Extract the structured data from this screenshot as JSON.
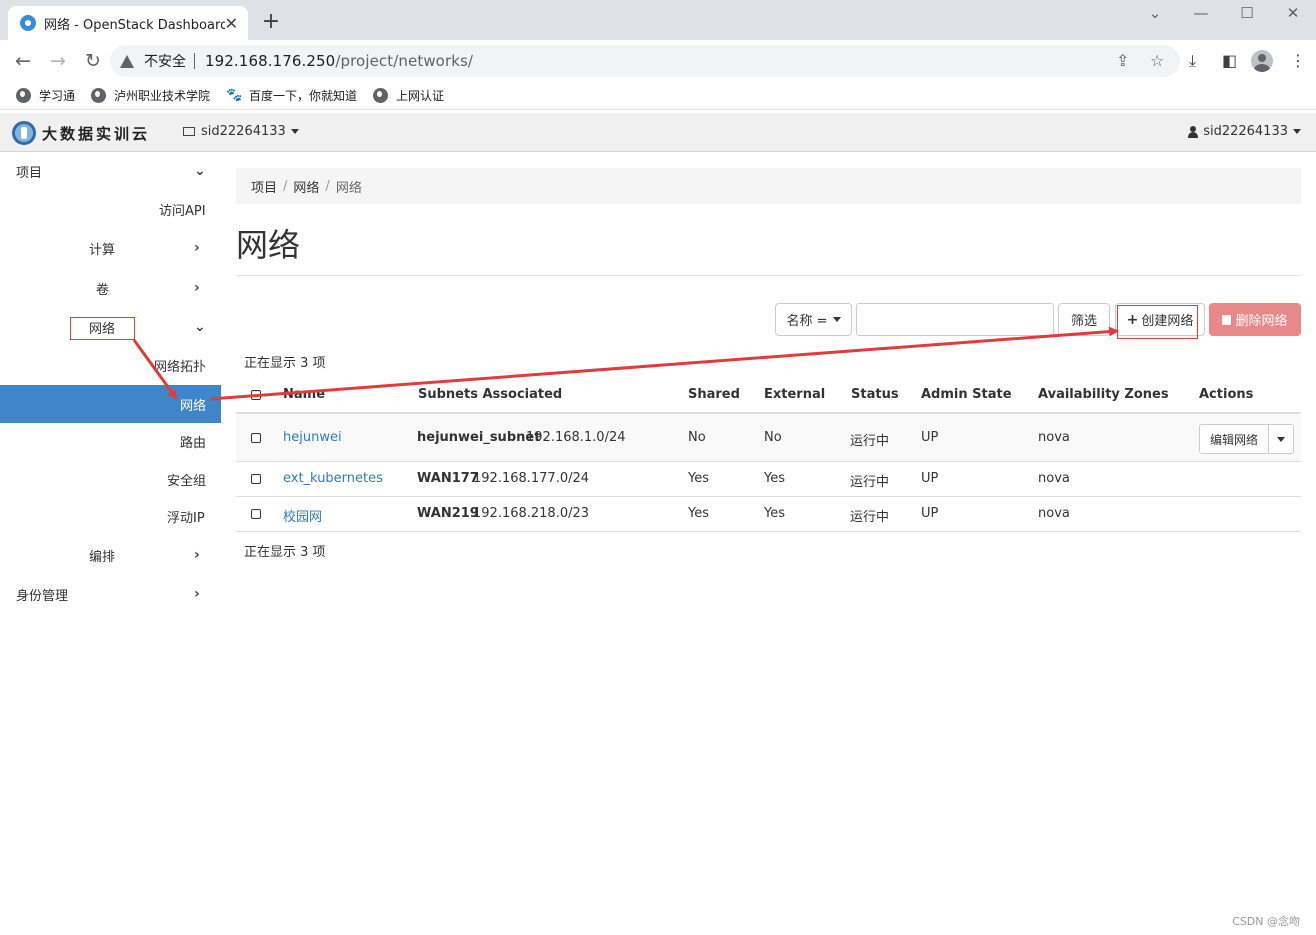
{
  "browser": {
    "tab_title": "网络 - OpenStack Dashboard",
    "tab_close": "✕",
    "new_tab": "+",
    "window_controls": {
      "chevron": "⌄",
      "minimize": "—",
      "maximize": "☐",
      "close": "✕"
    },
    "nav": {
      "back": "←",
      "forward": "→",
      "reload": "↻"
    },
    "security_label": "不安全",
    "url_host": "192.168.176.250",
    "url_path": "/project/networks/",
    "omnibox_icons": [
      "share-icon",
      "star-icon"
    ],
    "toolbar_icons": [
      "download-icon",
      "sidepanel-icon",
      "profile-icon",
      "menu-icon"
    ],
    "bookmarks": [
      {
        "label": "学习通",
        "icon": "globe-icon"
      },
      {
        "label": "泸州职业技术学院",
        "icon": "globe-icon"
      },
      {
        "label": "百度一下，你就知道",
        "icon": "baidu-paw-icon"
      },
      {
        "label": "上网认证",
        "icon": "globe-icon"
      }
    ]
  },
  "header": {
    "brand": "大数据实训云",
    "project": "sid22264133",
    "user": "sid22264133"
  },
  "sidebar": {
    "items": [
      {
        "label": "项目",
        "chevron": "⌄"
      },
      {
        "label": "访问API"
      },
      {
        "label": "计算",
        "chevron": "›"
      },
      {
        "label": "卷",
        "chevron": "›"
      },
      {
        "label": "网络",
        "chevron": "⌄",
        "highlighted": true
      },
      {
        "label": "网络拓扑"
      },
      {
        "label": "网络",
        "active": true
      },
      {
        "label": "路由"
      },
      {
        "label": "安全组"
      },
      {
        "label": "浮动IP"
      },
      {
        "label": "编排",
        "chevron": "›"
      },
      {
        "label": "身份管理",
        "chevron": "›"
      }
    ]
  },
  "breadcrumb": [
    "项目",
    "网络",
    "网络"
  ],
  "page_title": "网络",
  "filter": {
    "dropdown_label": "名称 =",
    "input_value": "",
    "filter_button": "筛选",
    "create_button": "创建网络",
    "delete_button": "删除网络"
  },
  "count_text": "正在显示 3 项",
  "table": {
    "headers": [
      "Name",
      "Subnets Associated",
      "Shared",
      "External",
      "Status",
      "Admin State",
      "Availability Zones",
      "Actions"
    ],
    "rows": [
      {
        "name": "hejunwei",
        "subnet_name": "hejunwei_subnet",
        "subnet_cidr": "192.168.1.0/24",
        "shared": "No",
        "external": "No",
        "status": "运行中",
        "admin_state": "UP",
        "zone": "nova",
        "action": "编辑网络"
      },
      {
        "name": "ext_kubernetes",
        "subnet_name": "WAN177",
        "subnet_cidr": "192.168.177.0/24",
        "shared": "Yes",
        "external": "Yes",
        "status": "运行中",
        "admin_state": "UP",
        "zone": "nova",
        "action": ""
      },
      {
        "name": "校园网",
        "subnet_name": "WAN219",
        "subnet_cidr": "192.168.218.0/23",
        "shared": "Yes",
        "external": "Yes",
        "status": "运行中",
        "admin_state": "UP",
        "zone": "nova",
        "action": ""
      }
    ]
  },
  "annotation_color": "#e03c3c",
  "accent_color": "#3e86c9",
  "watermark": "CSDN @念吻"
}
